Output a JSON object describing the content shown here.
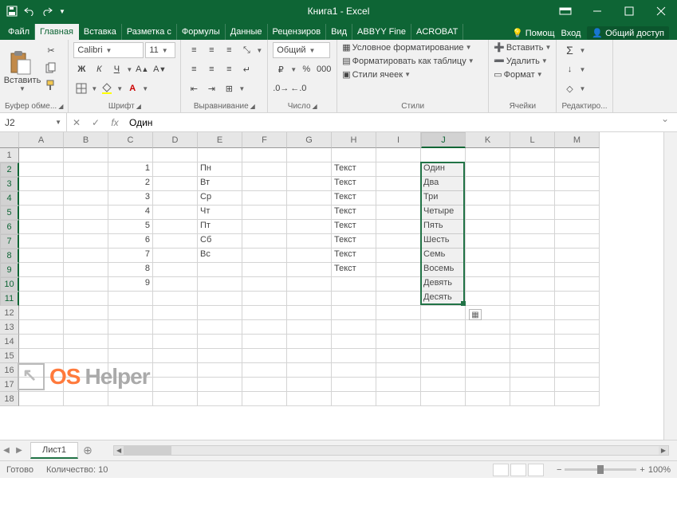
{
  "app": {
    "title": "Книга1 - Excel"
  },
  "tabs": {
    "file": "Файл",
    "items": [
      "Главная",
      "Вставка",
      "Разметка с",
      "Формулы",
      "Данные",
      "Рецензиров",
      "Вид",
      "ABBYY Fine",
      "ACROBAT"
    ],
    "active": 0,
    "help": "Помощ",
    "signin": "Вход",
    "share": "Общий доступ"
  },
  "ribbon": {
    "clipboard": {
      "paste": "Вставить",
      "label": "Буфер обме..."
    },
    "font": {
      "name": "Calibri",
      "size": "11",
      "bold": "Ж",
      "italic": "К",
      "underline": "Ч",
      "label": "Шрифт"
    },
    "align": {
      "label": "Выравнивание"
    },
    "number": {
      "format": "Общий",
      "label": "Число"
    },
    "styles": {
      "cond": "Условное форматирование",
      "table": "Форматировать как таблицу",
      "cell": "Стили ячеек",
      "label": "Стили"
    },
    "cells": {
      "insert": "Вставить",
      "delete": "Удалить",
      "format": "Формат",
      "label": "Ячейки"
    },
    "editing": {
      "label": "Редактиро..."
    }
  },
  "formula": {
    "ref": "J2",
    "value": "Один"
  },
  "grid": {
    "cols": [
      "A",
      "B",
      "C",
      "D",
      "E",
      "F",
      "G",
      "H",
      "I",
      "J",
      "K",
      "L",
      "M"
    ],
    "selCol": 9,
    "rowCount": 18,
    "selRows": [
      1,
      2,
      3,
      4,
      5,
      6,
      7,
      8,
      9,
      10
    ],
    "data": {
      "C": [
        "1",
        "2",
        "3",
        "4",
        "5",
        "6",
        "7",
        "8",
        "9"
      ],
      "E": [
        "Пн",
        "Вт",
        "Ср",
        "Чт",
        "Пт",
        "Сб",
        "Вс"
      ],
      "H": [
        "Текст",
        "Текст",
        "Текст",
        "Текст",
        "Текст",
        "Текст",
        "Текст",
        "Текст"
      ],
      "J": [
        "Один",
        "Два",
        "Три",
        "Четыре",
        "Пять",
        "Шесть",
        "Семь",
        "Восемь",
        "Девять",
        "Десять"
      ]
    }
  },
  "sheets": {
    "active": "Лист1"
  },
  "status": {
    "ready": "Готово",
    "count_label": "Количество:",
    "count": "10",
    "zoom": "100%"
  }
}
